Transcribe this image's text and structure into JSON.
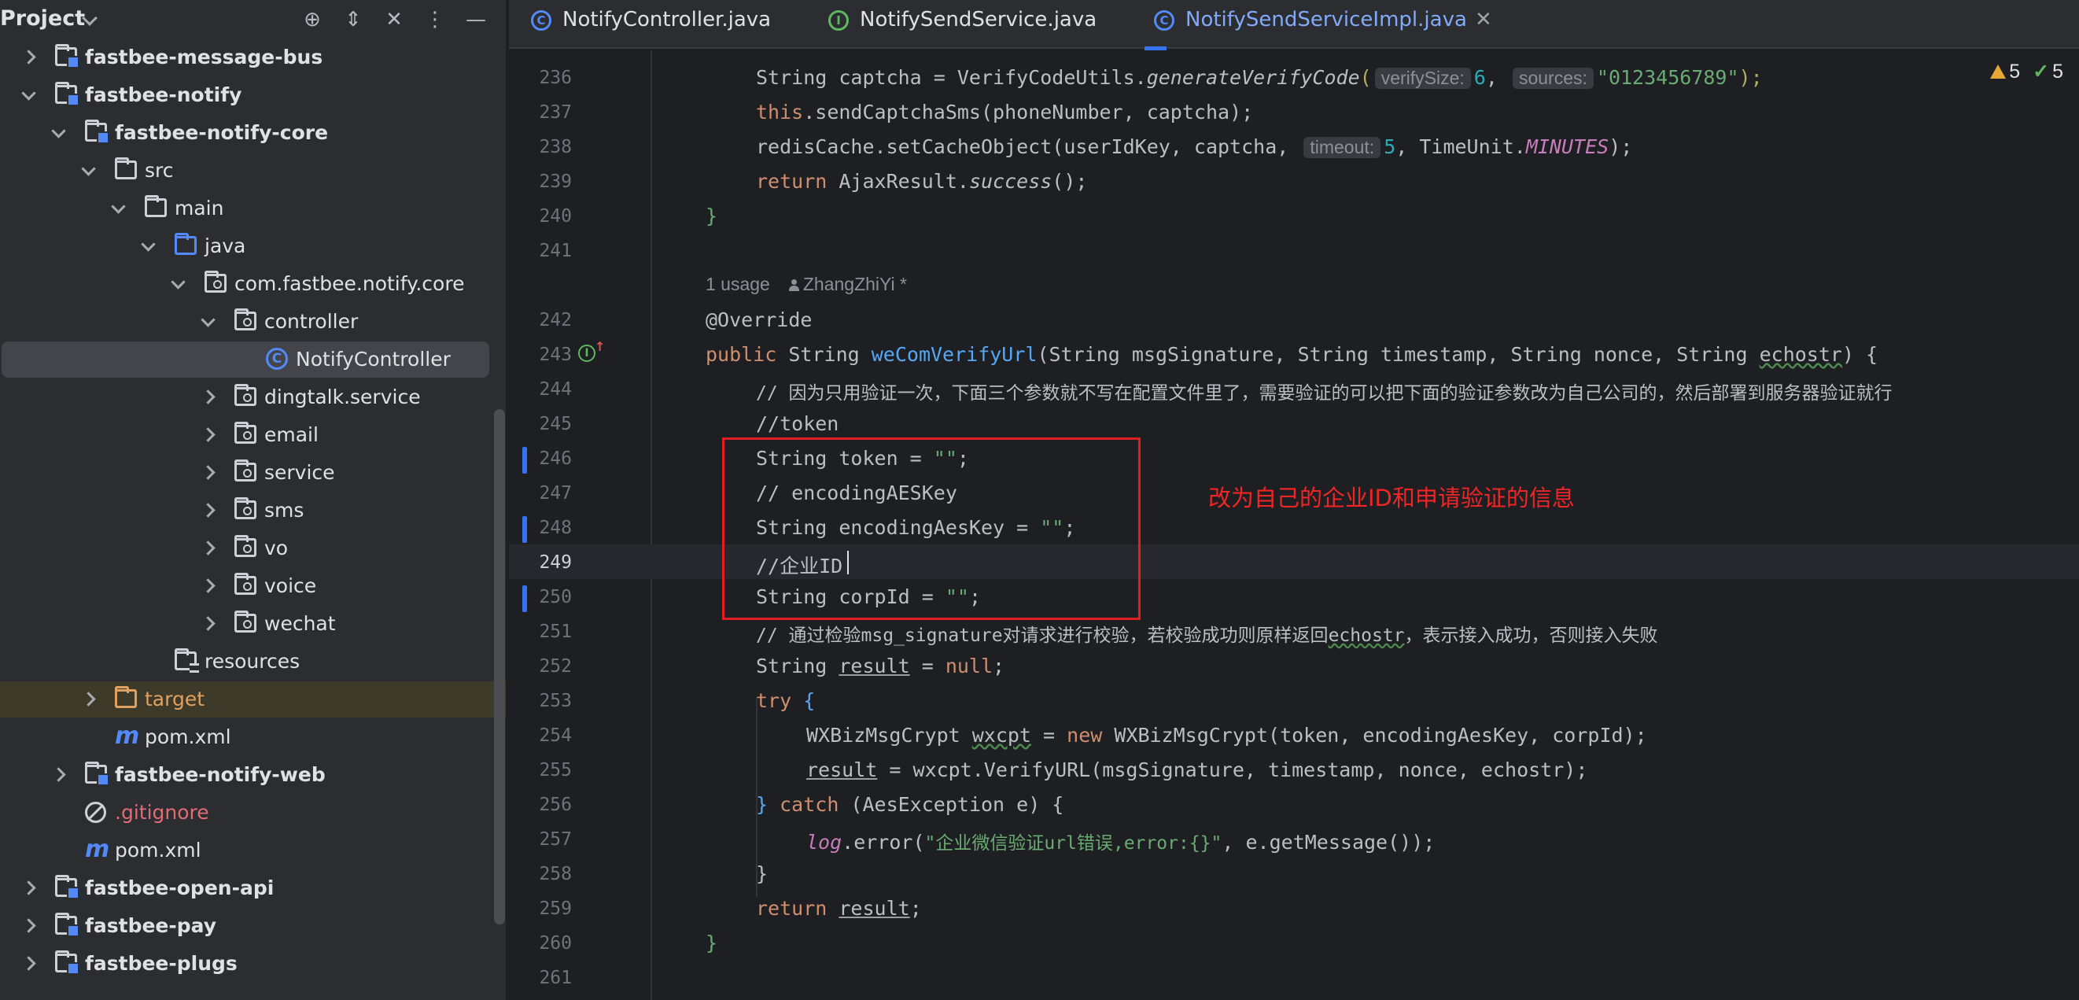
{
  "project_panel": {
    "title": "Project",
    "tree": [
      {
        "label": "fastbee-message-bus",
        "level": 0,
        "state": "collapsed",
        "icon": "module-folder",
        "bold": true
      },
      {
        "label": "fastbee-notify",
        "level": 0,
        "state": "expanded",
        "icon": "module-folder",
        "bold": true
      },
      {
        "label": "fastbee-notify-core",
        "level": 1,
        "state": "expanded",
        "icon": "module-folder",
        "bold": true
      },
      {
        "label": "src",
        "level": 2,
        "state": "expanded",
        "icon": "folder"
      },
      {
        "label": "main",
        "level": 3,
        "state": "expanded",
        "icon": "folder"
      },
      {
        "label": "java",
        "level": 4,
        "state": "expanded",
        "icon": "source-folder"
      },
      {
        "label": "com.fastbee.notify.core",
        "level": 5,
        "state": "expanded",
        "icon": "package"
      },
      {
        "label": "controller",
        "level": 6,
        "state": "expanded",
        "icon": "package"
      },
      {
        "label": "NotifyController",
        "level": 7,
        "state": "leaf",
        "icon": "class",
        "selected": true
      },
      {
        "label": "dingtalk.service",
        "level": 6,
        "state": "collapsed",
        "icon": "package"
      },
      {
        "label": "email",
        "level": 6,
        "state": "collapsed",
        "icon": "package"
      },
      {
        "label": "service",
        "level": 6,
        "state": "collapsed",
        "icon": "package"
      },
      {
        "label": "sms",
        "level": 6,
        "state": "collapsed",
        "icon": "package"
      },
      {
        "label": "vo",
        "level": 6,
        "state": "collapsed",
        "icon": "package"
      },
      {
        "label": "voice",
        "level": 6,
        "state": "collapsed",
        "icon": "package"
      },
      {
        "label": "wechat",
        "level": 6,
        "state": "collapsed",
        "icon": "package"
      },
      {
        "label": "resources",
        "level": 4,
        "state": "leaf",
        "icon": "resources-folder"
      },
      {
        "label": "target",
        "level": 2,
        "state": "collapsed",
        "icon": "excluded-folder",
        "color": "#e0a060"
      },
      {
        "label": "pom.xml",
        "level": 2,
        "state": "leaf",
        "icon": "maven-file"
      },
      {
        "label": "fastbee-notify-web",
        "level": 1,
        "state": "collapsed",
        "icon": "module-folder",
        "bold": true
      },
      {
        "label": ".gitignore",
        "level": 1,
        "state": "leaf",
        "icon": "ignore-file",
        "color": "#e06c75"
      },
      {
        "label": "pom.xml",
        "level": 1,
        "state": "leaf",
        "icon": "maven-file"
      },
      {
        "label": "fastbee-open-api",
        "level": 0,
        "state": "collapsed",
        "icon": "module-folder",
        "bold": true
      },
      {
        "label": "fastbee-pay",
        "level": 0,
        "state": "collapsed",
        "icon": "module-folder",
        "bold": true
      },
      {
        "label": "fastbee-plugs",
        "level": 0,
        "state": "collapsed",
        "icon": "module-folder",
        "bold": true
      }
    ]
  },
  "tabs": [
    {
      "label": "NotifyController.java",
      "icon": "class-icon",
      "icon_glyph": "C",
      "active": false
    },
    {
      "label": "NotifySendService.java",
      "icon": "interface-icon",
      "icon_glyph": "I",
      "active": false
    },
    {
      "label": "NotifySendServiceImpl.java",
      "icon": "class-icon",
      "icon_glyph": "C",
      "active": true
    }
  ],
  "inspections": {
    "warnings": "5",
    "ok": "5"
  },
  "usage": {
    "count": "1 usage",
    "author": "ZhangZhiYi *"
  },
  "code": {
    "l236": {
      "n": "236",
      "a": "String captcha = VerifyCodeUtils.",
      "b": "generateVerifyCode",
      "c": "(",
      "h1": "verifySize:",
      "v1": "6",
      "d": ", ",
      "h2": "sources:",
      "v2": "\"0123456789\"",
      "e": ");"
    },
    "l237": {
      "n": "237",
      "a": "this",
      "b": ".sendCaptchaSms(phoneNumber, captcha);"
    },
    "l238": {
      "n": "238",
      "a": "redisCache.setCacheObject(userIdKey, captcha, ",
      "h1": "timeout:",
      "v1": "5",
      "b": ", TimeUnit.",
      "c": "MINUTES",
      "d": ");"
    },
    "l239": {
      "n": "239",
      "a": "return",
      "b": " AjaxResult.",
      "c": "success",
      "d": "();"
    },
    "l240": {
      "n": "240",
      "a": "}"
    },
    "l241": {
      "n": "241"
    },
    "l242": {
      "n": "242",
      "a": "@Override"
    },
    "l243": {
      "n": "243",
      "a": "public",
      "b": " String ",
      "c": "weComVerifyUrl",
      "d": "(String msgSignature, String timestamp, String nonce, String ",
      "e": "echostr",
      "f": ") {"
    },
    "l244": {
      "n": "244",
      "a": "// 因为只用验证一次，下面三个参数就不写在配置文件里了，需要验证的可以把下面的验证参数改为自己公司的，然后部署到服务器验证就行"
    },
    "l245": {
      "n": "245",
      "a": "//token"
    },
    "l246": {
      "n": "246",
      "a": "String token = ",
      "b": "\"\"",
      "c": ";"
    },
    "l247": {
      "n": "247",
      "a": "// encodingAESKey"
    },
    "l248": {
      "n": "248",
      "a": "String encodingAesKey = ",
      "b": "\"\"",
      "c": ";"
    },
    "l249": {
      "n": "249",
      "a": "//企业ID"
    },
    "l250": {
      "n": "250",
      "a": "String corpId = ",
      "b": "\"\"",
      "c": ";"
    },
    "l251": {
      "n": "251",
      "a": "// 通过检验msg_signature对请求进行校验，若校验成功则原样返回",
      "b": "echostr",
      "c": "，表示接入成功，否则接入失败"
    },
    "l252": {
      "n": "252",
      "a": "String ",
      "b": "result",
      "c": " = ",
      "d": "null",
      "e": ";"
    },
    "l253": {
      "n": "253",
      "a": "try",
      "b": " {"
    },
    "l254": {
      "n": "254",
      "a": "WXBizMsgCrypt ",
      "b": "wxcpt",
      "c": " = ",
      "d": "new",
      "e": " WXBizMsgCrypt(token, encodingAesKey, corpId);"
    },
    "l255": {
      "n": "255",
      "a": "result",
      "b": " = wxcpt.VerifyURL(msgSignature, timestamp, nonce, echostr);"
    },
    "l256": {
      "n": "256",
      "a": "} ",
      "b": "catch",
      "c": " (AesException e) {"
    },
    "l257": {
      "n": "257",
      "a": "log",
      "b": ".error(",
      "c": "\"企业微信验证url错误,error:{}\"",
      "d": ", e.getMessage());"
    },
    "l258": {
      "n": "258",
      "a": "}"
    },
    "l259": {
      "n": "259",
      "a": "return",
      "b": " ",
      "c": "result",
      "d": ";"
    },
    "l260": {
      "n": "260",
      "a": "}"
    },
    "l261": {
      "n": "261"
    }
  },
  "annotation": {
    "text": "改为自己的企业ID和申请验证的信息",
    "color": "#f02525"
  }
}
